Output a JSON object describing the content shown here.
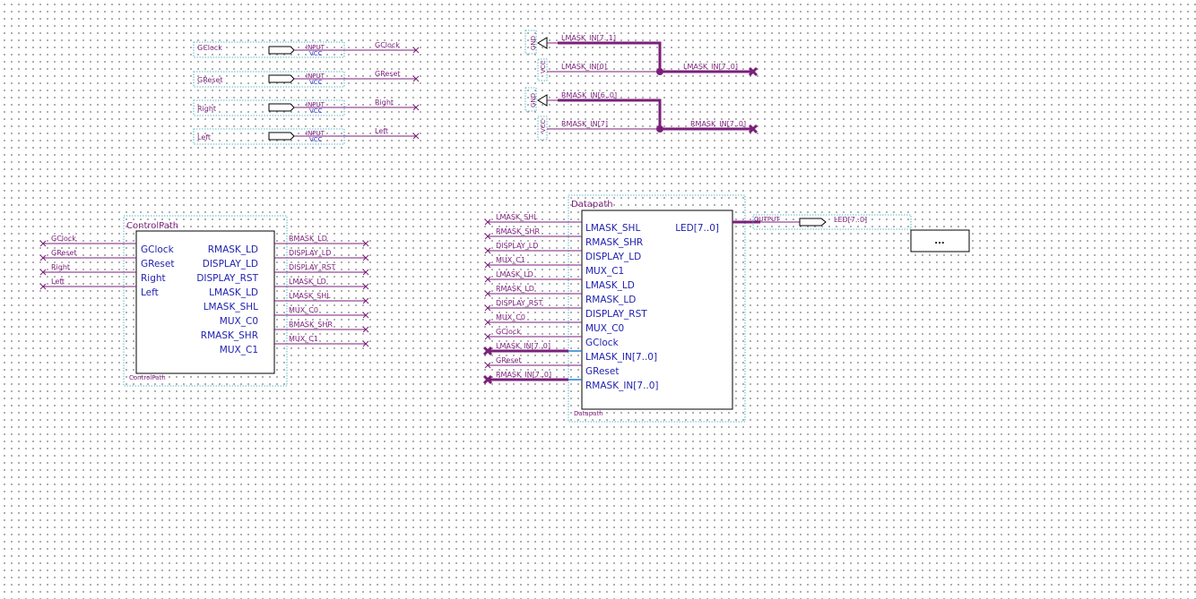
{
  "input_pins": [
    {
      "name": "GClock",
      "type": "INPUT",
      "sub": "VCC",
      "net": "GClock"
    },
    {
      "name": "GReset",
      "type": "INPUT",
      "sub": "VCC",
      "net": "GReset"
    },
    {
      "name": "Right",
      "type": "INPUT",
      "sub": "VCC",
      "net": "Right"
    },
    {
      "name": "Left",
      "type": "INPUT",
      "sub": "VCC",
      "net": "Left"
    }
  ],
  "gnd_label": "GND",
  "vcc_label": "VCC",
  "buses": {
    "lmask": {
      "hi": "LMASK_IN[7..1]",
      "lo": "LMASK_IN[0]",
      "out": "LMASK_IN[7..0]"
    },
    "rmask": {
      "hi": "RMASK_IN[6..0]",
      "lo": "RMASK_IN[7]",
      "out": "RMASK_IN[7..0]"
    }
  },
  "controlpath": {
    "title": "ControlPath",
    "instance": "ControlPath",
    "inputs": [
      "GClock",
      "GReset",
      "Right",
      "Left"
    ],
    "outputs": [
      "RMASK_LD",
      "DISPLAY_LD",
      "DISPLAY_RST",
      "LMASK_LD",
      "LMASK_SHL",
      "MUX_C0",
      "RMASK_SHR",
      "MUX_C1"
    ],
    "in_wires": [
      "GClock",
      "GReset",
      "Right",
      "Left"
    ],
    "out_wires": [
      "RMASK_LD",
      "DISPLAY_LD",
      "DISPLAY_RST",
      "LMASK_LD",
      "LMASK_SHL",
      "MUX_C0",
      "RMASK_SHR",
      "MUX_C1"
    ]
  },
  "datapath": {
    "title": "Datapath",
    "instance": "Datapath",
    "inputs": [
      "LMASK_SHL",
      "RMASK_SHR",
      "DISPLAY_LD",
      "MUX_C1",
      "LMASK_LD",
      "RMASK_LD",
      "DISPLAY_RST",
      "MUX_C0",
      "GClock",
      "LMASK_IN[7..0]",
      "GReset",
      "RMASK_IN[7..0]"
    ],
    "output": "LED[7..0]",
    "in_wires": [
      "LMASK_SHL",
      "RMASK_SHR",
      "DISPLAY_LD",
      "MUX_C1",
      "LMASK_LD",
      "RMASK_LD",
      "DISPLAY_RST",
      "MUX_C0",
      "GClock",
      "LMASK_IN[7..0]",
      "GReset",
      "RMASK_IN[7..0]"
    ]
  },
  "output_pin": {
    "type": "OUTPUT",
    "name": "LED[7..0]"
  },
  "more_box": "..."
}
